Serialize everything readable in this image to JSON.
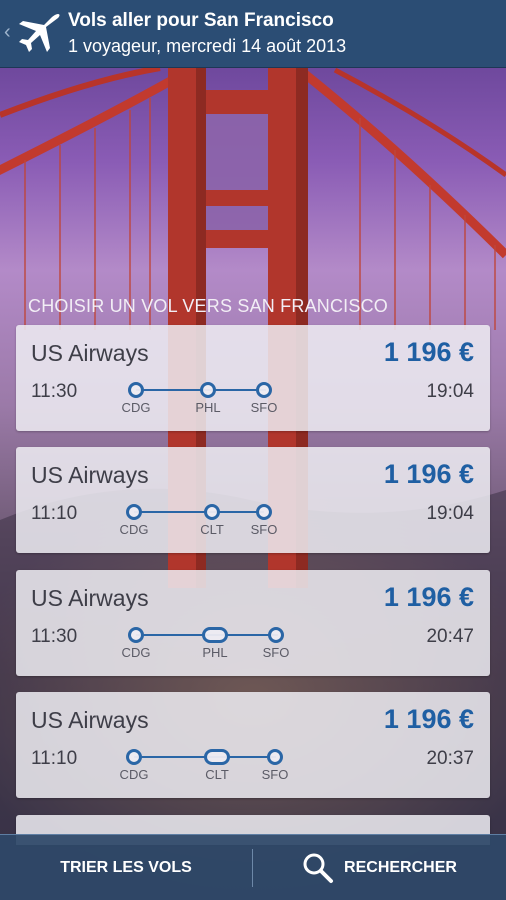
{
  "header": {
    "title": "Vols aller pour San Francisco",
    "subtitle": "1 voyageur, mercredi 14 août 2013",
    "back_glyph": "‹",
    "icons": [
      "back-chevron-icon",
      "plane-icon"
    ]
  },
  "section_title": "CHOISIR UN VOL VERS SAN FRANCISCO",
  "flights": [
    {
      "airline": "US Airways",
      "price": "1 196 €",
      "departure": "11:30",
      "arrival": "19:04",
      "stops": [
        {
          "code": "CDG"
        },
        {
          "code": "PHL"
        },
        {
          "code": "SFO"
        }
      ]
    },
    {
      "airline": "US Airways",
      "price": "1 196 €",
      "departure": "11:10",
      "arrival": "19:04",
      "stops": [
        {
          "code": "CDG"
        },
        {
          "code": "CLT"
        },
        {
          "code": "SFO"
        }
      ]
    },
    {
      "airline": "US Airways",
      "price": "1 196 €",
      "departure": "11:30",
      "arrival": "20:47",
      "stops": [
        {
          "code": "CDG"
        },
        {
          "code": "PHL"
        },
        {
          "code": "SFO"
        }
      ]
    },
    {
      "airline": "US Airways",
      "price": "1 196 €",
      "departure": "11:10",
      "arrival": "20:37",
      "stops": [
        {
          "code": "CDG"
        },
        {
          "code": "CLT"
        },
        {
          "code": "SFO"
        }
      ]
    }
  ],
  "bottom_bar": {
    "sort_label": "TRIER LES VOLS",
    "search_label": "RECHERCHER",
    "search_icon": "search-icon"
  },
  "colors": {
    "header_bg": "#2b4d74",
    "price": "#1f5fa3",
    "route_line": "#2a66a6",
    "bottom_bar_bg": "#2e4868"
  }
}
